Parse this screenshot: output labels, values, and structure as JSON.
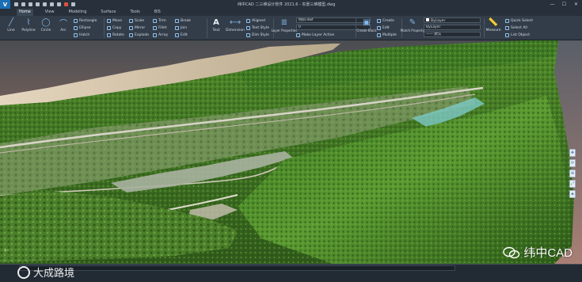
{
  "app": {
    "title": "纬中CAD 二三维设计软件 2021.6 - 实景三维模型.dwg",
    "logo_letter": "V"
  },
  "menu": {
    "tabs": [
      "Home",
      "View",
      "Modeling",
      "Surface",
      "Tools",
      "BIS"
    ],
    "active_tab": "Home"
  },
  "ribbon": {
    "draw": {
      "line": "Line",
      "polyline": "Polyline",
      "circle": "Circle",
      "arc": "Arc",
      "rectangle": "Rectangle",
      "ellipse": "Ellipse",
      "hatch": "Hatch"
    },
    "modify": {
      "move": "Move",
      "copy": "Copy",
      "rotate": "Rotate",
      "scale": "Scale",
      "mirror": "Mirror",
      "explode": "Explode",
      "trim": "Trim",
      "fillet": "Fillet",
      "array": "Array",
      "break": "Break",
      "join": "Join",
      "edit": "Edit"
    },
    "annotation": {
      "text": "Text",
      "dimension": "Dimension",
      "aligned": "Aligned",
      "text_style": "Text Style",
      "dim_style": "Dim Style"
    },
    "layers": {
      "layer_properties": "Layer Properties",
      "current_layer": "倾斜.dwf",
      "layer_zero": "0",
      "make_layer_active": "Make Layer Active"
    },
    "block": {
      "create_block": "Create Block",
      "create": "Create",
      "edit": "Edit",
      "multiple": "Multiple"
    },
    "properties": {
      "match_property": "Match Property",
      "color": "ByLayer",
      "linetype": "ByLayer",
      "lineweight": "—— 默认"
    },
    "utilities": {
      "measure": "Measure",
      "quick_select": "Quick Select",
      "select_all": "Select All",
      "list_object": "List Object"
    }
  },
  "viewport": {
    "nav_icons": [
      "pan-icon",
      "orbit-icon",
      "zoom-icon",
      "zoom-extents-icon",
      "view-cube-icon"
    ]
  },
  "watermarks": {
    "left": "大成路境",
    "right": "纬中CAD"
  },
  "colors": {
    "accent": "#1a6fb5",
    "ribbon_bg": "#333d49",
    "titlebar_bg": "#27303b"
  }
}
